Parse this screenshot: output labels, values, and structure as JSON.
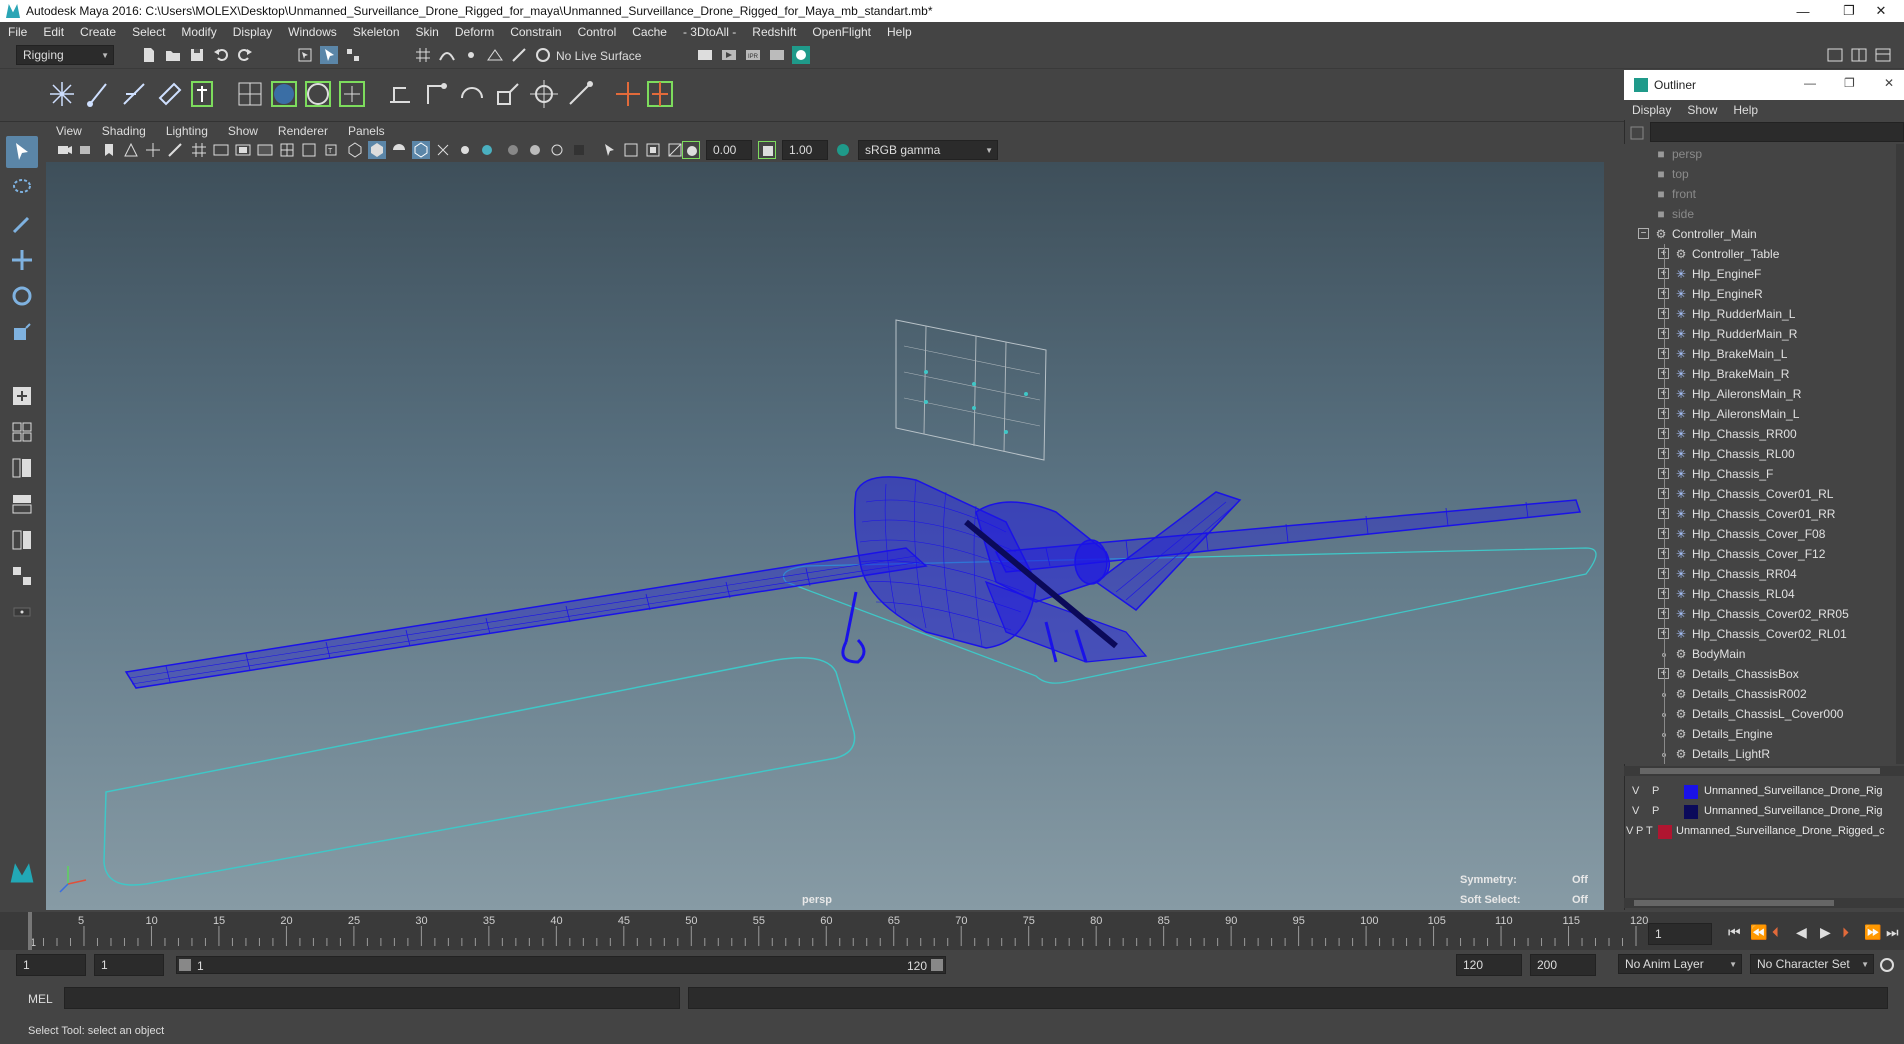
{
  "window": {
    "title": "Autodesk Maya 2016: C:\\Users\\MOLEX\\Desktop\\Unmanned_Surveillance_Drone_Rigged_for_maya\\Unmanned_Surveillance_Drone_Rigged_for_Maya_mb_standart.mb*",
    "minimize": "—",
    "restore": "❐",
    "close": "✕"
  },
  "menubar": [
    "File",
    "Edit",
    "Create",
    "Select",
    "Modify",
    "Display",
    "Windows",
    "Skeleton",
    "Skin",
    "Deform",
    "Constrain",
    "Control",
    "Cache",
    "- 3DtoAll -",
    "Redshift",
    "OpenFlight",
    "Help"
  ],
  "statusline": {
    "menuset": "Rigging",
    "live_surface": "No Live Surface"
  },
  "panel": {
    "menu": [
      "View",
      "Shading",
      "Lighting",
      "Show",
      "Renderer",
      "Panels"
    ],
    "exposure": "0.00",
    "gamma": "1.00",
    "colorspace": "sRGB gamma"
  },
  "viewport": {
    "camera": "persp",
    "symmetry_label": "Symmetry:",
    "symmetry_value": "Off",
    "soft_select_label": "Soft Select:",
    "soft_select_value": "Off",
    "accent": "#1a12e8",
    "curve_color": "#3fc7c7"
  },
  "outliner": {
    "title": "Outliner",
    "menu": [
      "Display",
      "Show",
      "Help"
    ],
    "items": [
      {
        "label": "persp",
        "depth": 0,
        "kind": "camera",
        "dim": true
      },
      {
        "label": "top",
        "depth": 0,
        "kind": "camera",
        "dim": true
      },
      {
        "label": "front",
        "depth": 0,
        "kind": "camera",
        "dim": true
      },
      {
        "label": "side",
        "depth": 0,
        "kind": "camera",
        "dim": true
      },
      {
        "label": "Controller_Main",
        "depth": 0,
        "kind": "curve",
        "expander": "−"
      },
      {
        "label": "Controller_Table",
        "depth": 1,
        "kind": "curve",
        "expander": "+"
      },
      {
        "label": "Hlp_EngineF",
        "depth": 1,
        "kind": "locator",
        "expander": "+"
      },
      {
        "label": "Hlp_EngineR",
        "depth": 1,
        "kind": "locator",
        "expander": "+"
      },
      {
        "label": "Hlp_RudderMain_L",
        "depth": 1,
        "kind": "locator",
        "expander": "+"
      },
      {
        "label": "Hlp_RudderMain_R",
        "depth": 1,
        "kind": "locator",
        "expander": "+"
      },
      {
        "label": "Hlp_BrakeMain_L",
        "depth": 1,
        "kind": "locator",
        "expander": "+"
      },
      {
        "label": "Hlp_BrakeMain_R",
        "depth": 1,
        "kind": "locator",
        "expander": "+"
      },
      {
        "label": "Hlp_AileronsMain_R",
        "depth": 1,
        "kind": "locator",
        "expander": "+"
      },
      {
        "label": "Hlp_AileronsMain_L",
        "depth": 1,
        "kind": "locator",
        "expander": "+"
      },
      {
        "label": "Hlp_Chassis_RR00",
        "depth": 1,
        "kind": "locator",
        "expander": "+"
      },
      {
        "label": "Hlp_Chassis_RL00",
        "depth": 1,
        "kind": "locator",
        "expander": "+"
      },
      {
        "label": "Hlp_Chassis_F",
        "depth": 1,
        "kind": "locator",
        "expander": "+"
      },
      {
        "label": "Hlp_Chassis_Cover01_RL",
        "depth": 1,
        "kind": "locator",
        "expander": "+"
      },
      {
        "label": "Hlp_Chassis_Cover01_RR",
        "depth": 1,
        "kind": "locator",
        "expander": "+"
      },
      {
        "label": "Hlp_Chassis_Cover_F08",
        "depth": 1,
        "kind": "locator",
        "expander": "+"
      },
      {
        "label": "Hlp_Chassis_Cover_F12",
        "depth": 1,
        "kind": "locator",
        "expander": "+"
      },
      {
        "label": "Hlp_Chassis_RR04",
        "depth": 1,
        "kind": "locator",
        "expander": "+"
      },
      {
        "label": "Hlp_Chassis_RL04",
        "depth": 1,
        "kind": "locator",
        "expander": "+"
      },
      {
        "label": "Hlp_Chassis_Cover02_RR05",
        "depth": 1,
        "kind": "locator",
        "expander": "+"
      },
      {
        "label": "Hlp_Chassis_Cover02_RL01",
        "depth": 1,
        "kind": "locator",
        "expander": "+"
      },
      {
        "label": "BodyMain",
        "depth": 1,
        "kind": "curve"
      },
      {
        "label": "Details_ChassisBox",
        "depth": 1,
        "kind": "curve",
        "expander": "+"
      },
      {
        "label": "Details_ChassisR002",
        "depth": 1,
        "kind": "curve"
      },
      {
        "label": "Details_ChassisL_Cover000",
        "depth": 1,
        "kind": "curve"
      },
      {
        "label": "Details_Engine",
        "depth": 1,
        "kind": "curve"
      },
      {
        "label": "Details_LightR",
        "depth": 1,
        "kind": "curve"
      }
    ]
  },
  "layers": [
    {
      "v": "V",
      "p": "P",
      "t": "",
      "color": "#1a12e8",
      "name": "Unmanned_Surveillance_Drone_Rig"
    },
    {
      "v": "V",
      "p": "P",
      "t": "",
      "color": "#0b0a5a",
      "name": "Unmanned_Surveillance_Drone_Rig"
    },
    {
      "v": "V",
      "p": "P",
      "t": "T",
      "color": "#b01530",
      "name": "Unmanned_Surveillance_Drone_Rigged_c"
    }
  ],
  "timeline": {
    "ticks": [
      "1",
      "5",
      "10",
      "15",
      "20",
      "25",
      "30",
      "35",
      "40",
      "45",
      "50",
      "55",
      "60",
      "65",
      "70",
      "75",
      "80",
      "85",
      "90",
      "95",
      "100",
      "105",
      "110",
      "115",
      "120"
    ],
    "current_frame": "1"
  },
  "range": {
    "start": "1",
    "start2": "1",
    "slider_start": "1",
    "slider_end": "120",
    "end": "120",
    "end2": "200",
    "anim_layer": "No Anim Layer",
    "char_set": "No Character Set"
  },
  "cmdline": {
    "label": "MEL"
  },
  "helpline": {
    "text": "Select Tool: select an object"
  }
}
